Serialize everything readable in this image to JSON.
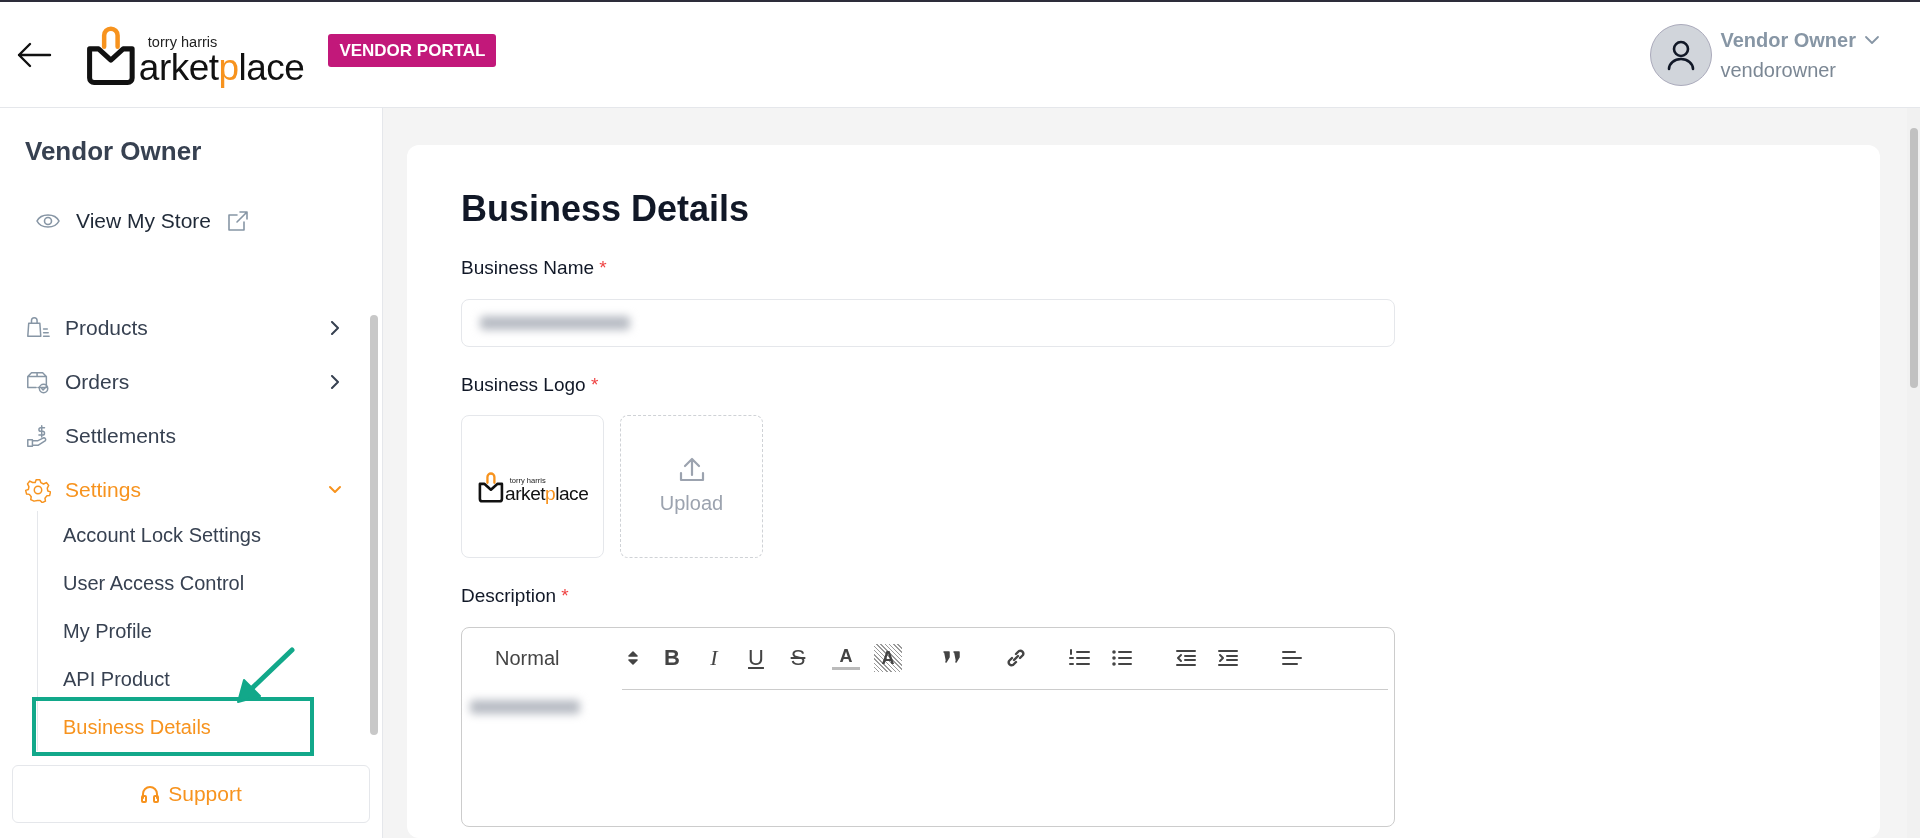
{
  "header": {
    "logo": {
      "tagline": "torry harris",
      "word": [
        {
          "text": "arket",
          "accent": false
        },
        {
          "text": "p",
          "accent": true
        },
        {
          "text": "lace",
          "accent": false
        }
      ]
    },
    "badge": "VENDOR PORTAL",
    "user": {
      "name": "Vendor Owner",
      "username": "vendorowner"
    }
  },
  "sidebar": {
    "title": "Vendor Owner",
    "store_link": "View My Store",
    "items": [
      {
        "label": "Products",
        "selected": false,
        "expanded": false
      },
      {
        "label": "Orders",
        "selected": false,
        "expanded": false
      },
      {
        "label": "Settlements",
        "selected": false
      },
      {
        "label": "Settings",
        "selected": true,
        "expanded": true,
        "children": [
          {
            "label": "Account Lock Settings",
            "selected": false
          },
          {
            "label": "User Access Control",
            "selected": false
          },
          {
            "label": "My Profile",
            "selected": false
          },
          {
            "label": "API Product",
            "selected": false
          },
          {
            "label": "Business Details",
            "selected": true
          }
        ]
      }
    ],
    "support": "Support"
  },
  "page": {
    "title": "Business Details",
    "fields": [
      {
        "kind": "text",
        "label": "Business Name",
        "required_mark": "*"
      },
      {
        "kind": "logo",
        "label": "Business Logo",
        "required_mark": "*",
        "image": {
          "tagline": "torry harris",
          "word": [
            {
              "text": "arket",
              "accent": false
            },
            {
              "text": "p",
              "accent": true
            },
            {
              "text": "lace",
              "accent": false
            }
          ]
        },
        "upload": "Upload"
      },
      {
        "kind": "editor",
        "label": "Description",
        "required_mark": "*",
        "format": "Normal",
        "tool_groups": [
          [
            {
              "kind": "text",
              "label": "B"
            },
            {
              "kind": "text",
              "label": "I"
            },
            {
              "kind": "text",
              "label": "U"
            },
            {
              "kind": "text",
              "label": "S"
            }
          ],
          [
            {
              "kind": "text",
              "label": "A"
            },
            {
              "kind": "text",
              "label": "A"
            }
          ],
          [
            {
              "kind": "icon"
            }
          ],
          [
            {
              "kind": "icon"
            }
          ],
          [
            {
              "kind": "icon"
            },
            {
              "kind": "icon"
            }
          ],
          [
            {
              "kind": "icon"
            },
            {
              "kind": "icon"
            }
          ],
          [
            {
              "kind": "icon"
            }
          ]
        ]
      }
    ]
  }
}
